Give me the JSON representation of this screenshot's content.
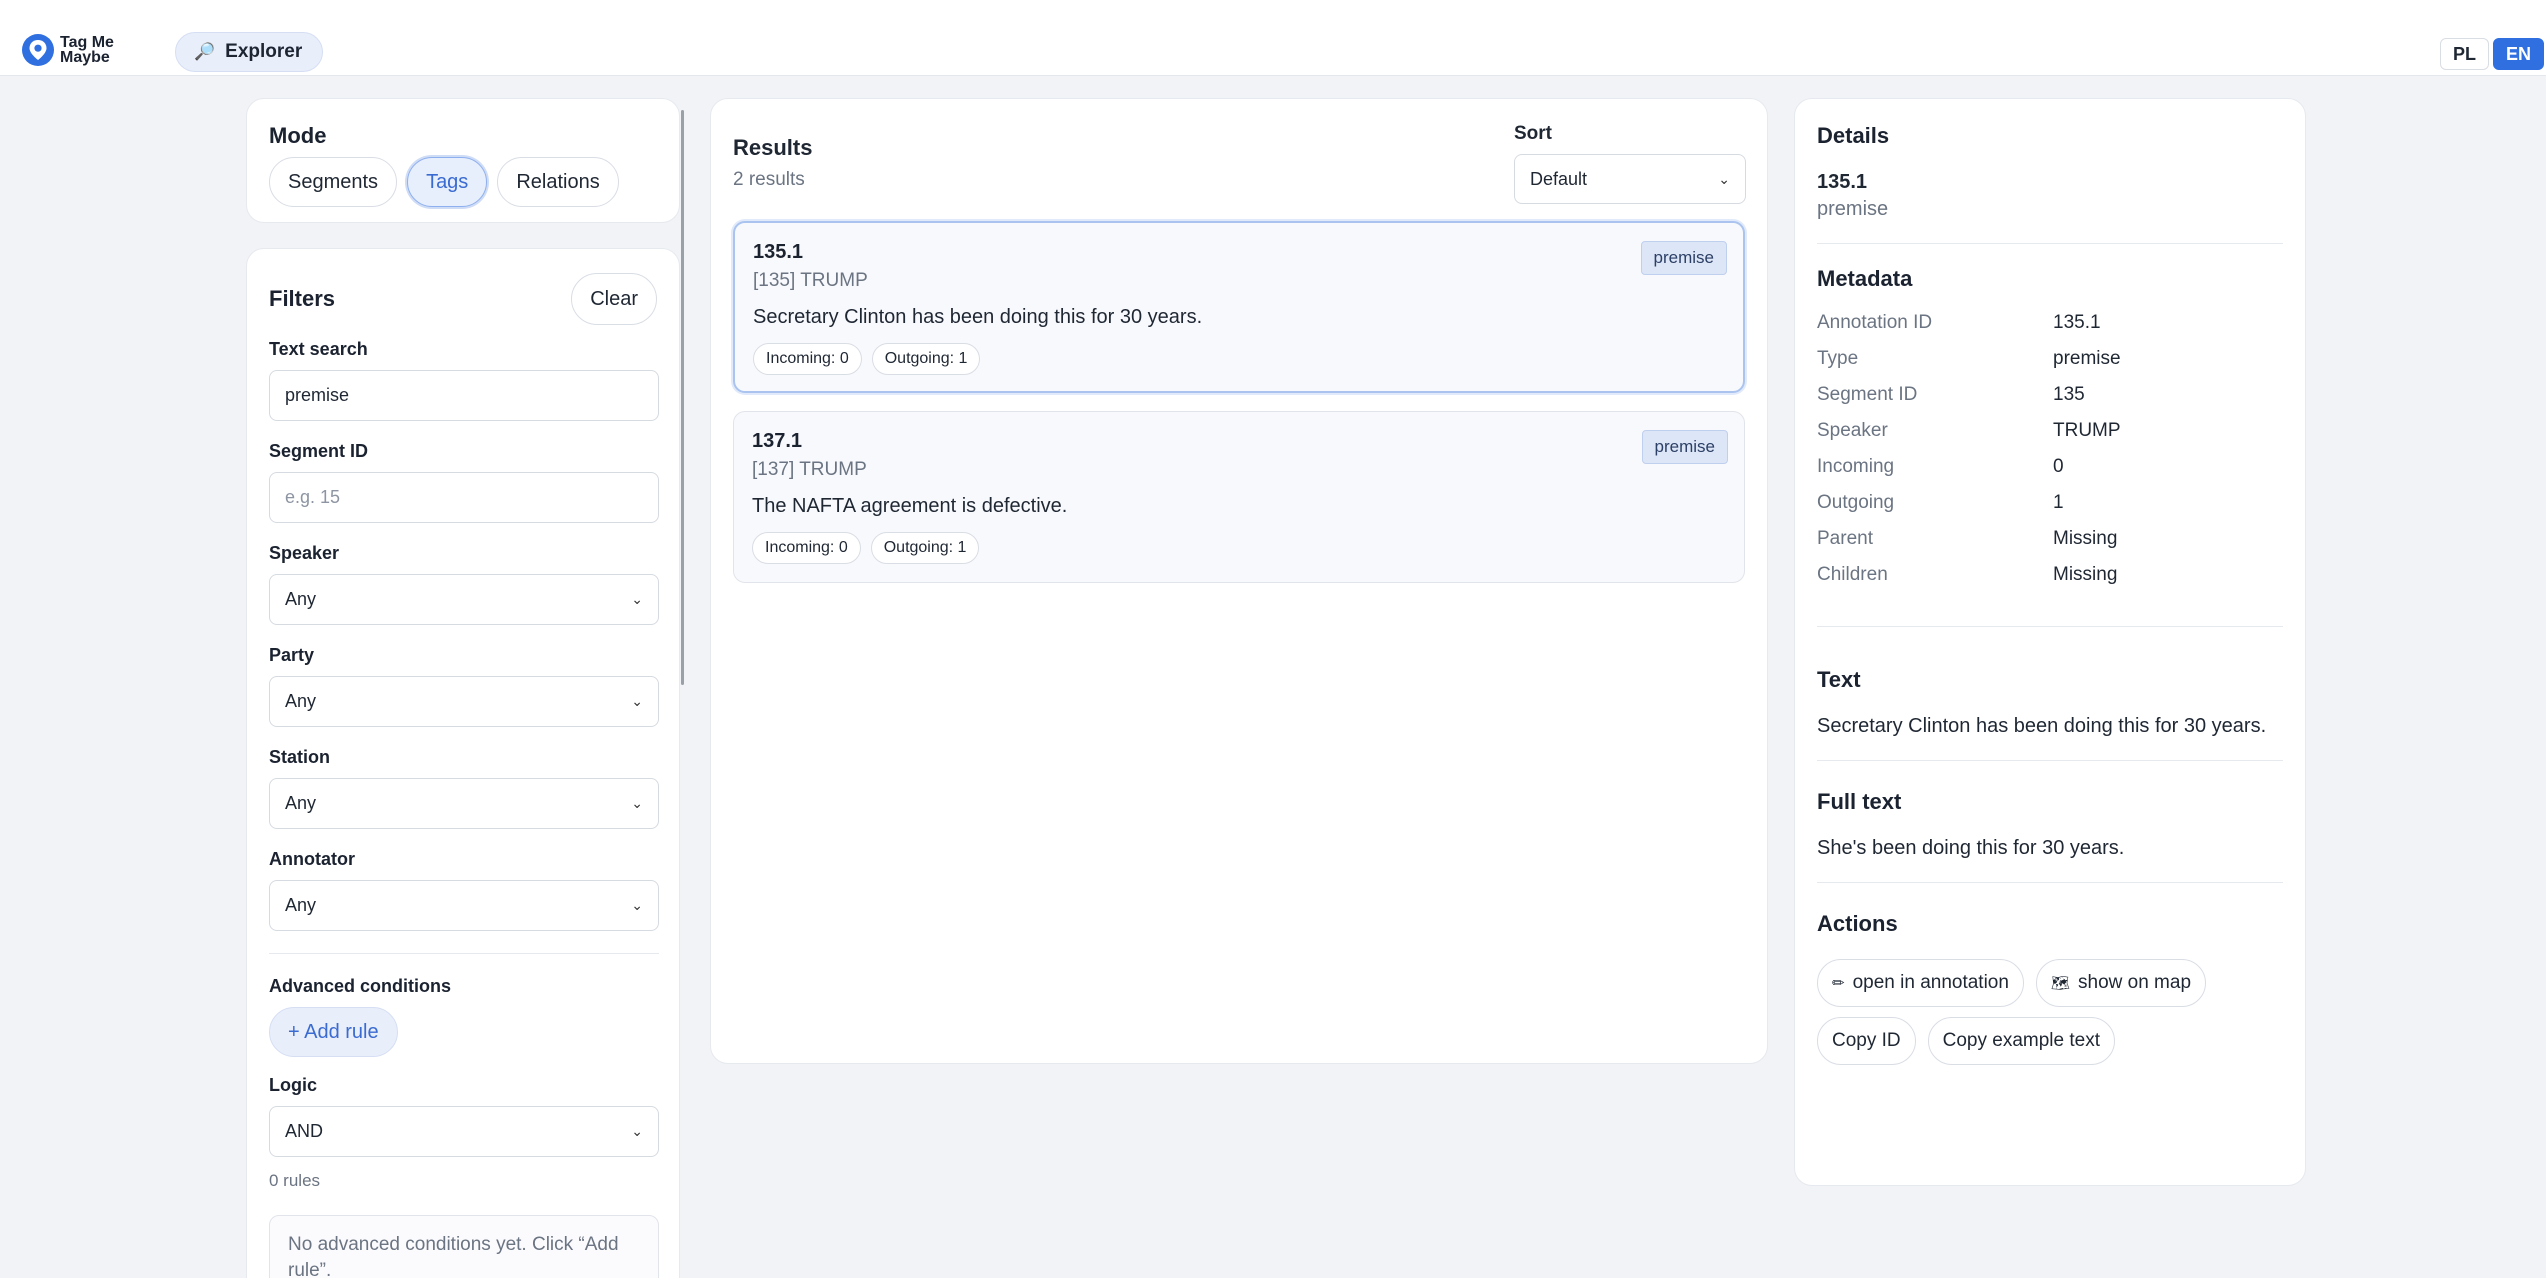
{
  "brand": {
    "name_line1": "Tag Me",
    "name_line2": "Maybe"
  },
  "nav": {
    "explorer_label": "Explorer"
  },
  "languages": [
    "PL",
    "EN"
  ],
  "mode": {
    "title": "Mode",
    "options": [
      "Segments",
      "Tags",
      "Relations"
    ],
    "active": "Tags"
  },
  "filters": {
    "title": "Filters",
    "clear_label": "Clear",
    "text_search": {
      "label": "Text search",
      "value": "premise"
    },
    "segment_id": {
      "label": "Segment ID",
      "placeholder": "e.g. 15"
    },
    "speaker": {
      "label": "Speaker",
      "value": "Any"
    },
    "party": {
      "label": "Party",
      "value": "Any"
    },
    "station": {
      "label": "Station",
      "value": "Any"
    },
    "annotator": {
      "label": "Annotator",
      "value": "Any"
    },
    "advanced": {
      "title": "Advanced conditions",
      "add_rule_label": "+ Add rule",
      "logic_label": "Logic",
      "logic_value": "AND",
      "rules_count": "0 rules",
      "empty_message": "No advanced conditions yet. Click “Add rule”."
    }
  },
  "results": {
    "title": "Results",
    "count": "2 results",
    "sort_label": "Sort",
    "sort_value": "Default",
    "items": [
      {
        "id": "135.1",
        "sub": "[135] TRUMP",
        "text": "Secretary Clinton has been doing this for 30 years.",
        "incoming": "Incoming: 0",
        "outgoing": "Outgoing: 1",
        "tag": "premise",
        "selected": true
      },
      {
        "id": "137.1",
        "sub": "[137] TRUMP",
        "text": "The NAFTA agreement is defective.",
        "incoming": "Incoming: 0",
        "outgoing": "Outgoing: 1",
        "tag": "premise",
        "selected": false
      }
    ]
  },
  "details": {
    "title": "Details",
    "id": "135.1",
    "type": "premise",
    "metadata_title": "Metadata",
    "metadata": [
      {
        "k": "Annotation ID",
        "v": "135.1"
      },
      {
        "k": "Type",
        "v": "premise"
      },
      {
        "k": "Segment ID",
        "v": "135"
      },
      {
        "k": "Speaker",
        "v": "TRUMP"
      },
      {
        "k": "Incoming",
        "v": "0"
      },
      {
        "k": "Outgoing",
        "v": "1"
      },
      {
        "k": "Parent",
        "v": "Missing"
      },
      {
        "k": "Children",
        "v": "Missing"
      }
    ],
    "text_title": "Text",
    "text": "Secretary Clinton has been doing this for 30 years.",
    "full_text_title": "Full text",
    "full_text": "She's been doing this for 30 years.",
    "actions_title": "Actions",
    "actions": {
      "open_annotation": "open in annotation",
      "show_on_map": "show on map",
      "copy_id": "Copy ID",
      "copy_example": "Copy example text"
    }
  },
  "colors": {
    "accent": "#2f6fe0",
    "background": "#f1f3f7",
    "tag_bg": "#dde6f6"
  }
}
